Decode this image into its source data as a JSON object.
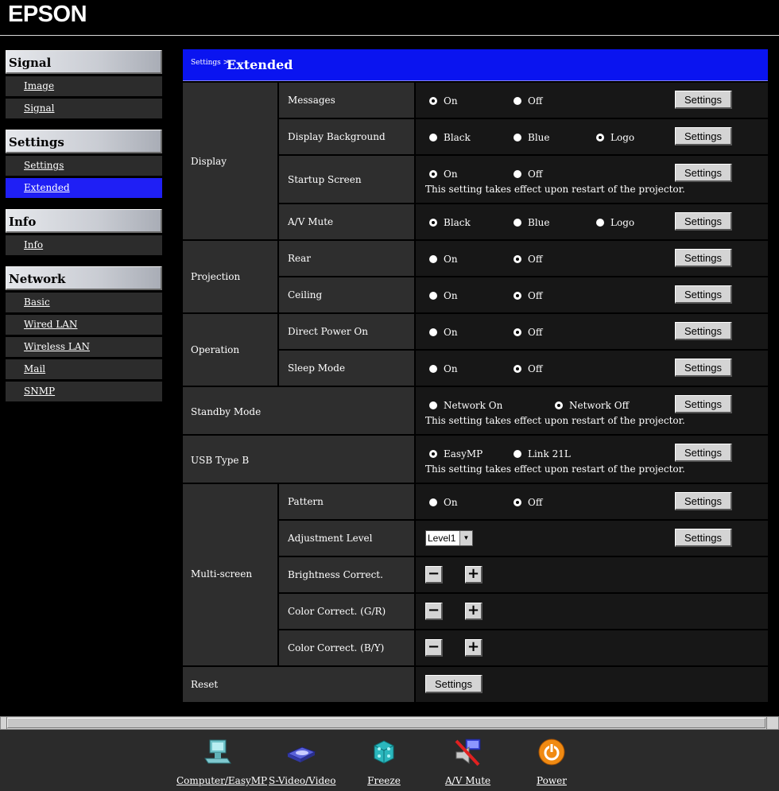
{
  "brand": "EPSON",
  "sidebar": {
    "groups": [
      {
        "title": "Signal",
        "items": [
          "Image",
          "Signal"
        ]
      },
      {
        "title": "Settings",
        "items": [
          "Settings",
          "Extended"
        ]
      },
      {
        "title": "Info",
        "items": [
          "Info"
        ]
      },
      {
        "title": "Network",
        "items": [
          "Basic",
          "Wired LAN",
          "Wireless LAN",
          "Mail",
          "SNMP"
        ]
      }
    ],
    "active": "Extended"
  },
  "header": {
    "crumb": "Settings >",
    "title": "Extended"
  },
  "sections": {
    "display": "Display",
    "projection": "Projection",
    "operation": "Operation",
    "standby": "Standby Mode",
    "usb": "USB Type B",
    "multiscreen": "Multi-screen",
    "reset": "Reset"
  },
  "rows": {
    "messages": {
      "label": "Messages",
      "options": [
        "On",
        "Off"
      ],
      "selected": "On"
    },
    "display_background": {
      "label": "Display Background",
      "options": [
        "Black",
        "Blue",
        "Logo"
      ],
      "selected": "Logo"
    },
    "startup_screen": {
      "label": "Startup Screen",
      "options": [
        "On",
        "Off"
      ],
      "selected": "On"
    },
    "av_mute": {
      "label": "A/V Mute",
      "options": [
        "Black",
        "Blue",
        "Logo"
      ],
      "selected": "Black"
    },
    "rear": {
      "label": "Rear",
      "options": [
        "On",
        "Off"
      ],
      "selected": "Off"
    },
    "ceiling": {
      "label": "Ceiling",
      "options": [
        "On",
        "Off"
      ],
      "selected": "Off"
    },
    "direct_power_on": {
      "label": "Direct Power On",
      "options": [
        "On",
        "Off"
      ],
      "selected": "Off"
    },
    "sleep_mode": {
      "label": "Sleep Mode",
      "options": [
        "On",
        "Off"
      ],
      "selected": "Off"
    },
    "standby_mode": {
      "options": [
        "Network On",
        "Network Off"
      ],
      "selected": "Network Off"
    },
    "usb_type_b": {
      "options": [
        "EasyMP",
        "Link 21L"
      ],
      "selected": "EasyMP"
    },
    "pattern": {
      "label": "Pattern",
      "options": [
        "On",
        "Off"
      ],
      "selected": "Off"
    },
    "adjustment_level": {
      "label": "Adjustment Level",
      "value": "Level1"
    },
    "brightness_correct": {
      "label": "Brightness Correct."
    },
    "color_correct_gr": {
      "label": "Color Correct. (G/R)"
    },
    "color_correct_by": {
      "label": "Color Correct. (B/Y)"
    }
  },
  "restart_note": "This setting takes effect upon restart of the projector.",
  "settings_button": "Settings",
  "minus": "−",
  "plus": "+",
  "dropdown_arrow": "▼",
  "toolbar": {
    "computer": "Computer/EasyMP",
    "svideo": "S-Video/Video",
    "freeze": "Freeze",
    "avmute": "A/V Mute",
    "power": "Power"
  },
  "icons": {
    "computer": "computer-icon",
    "svideo": "video-icon",
    "freeze": "ice-cube-icon",
    "avmute": "muted-monitor-icon",
    "power": "power-icon"
  }
}
